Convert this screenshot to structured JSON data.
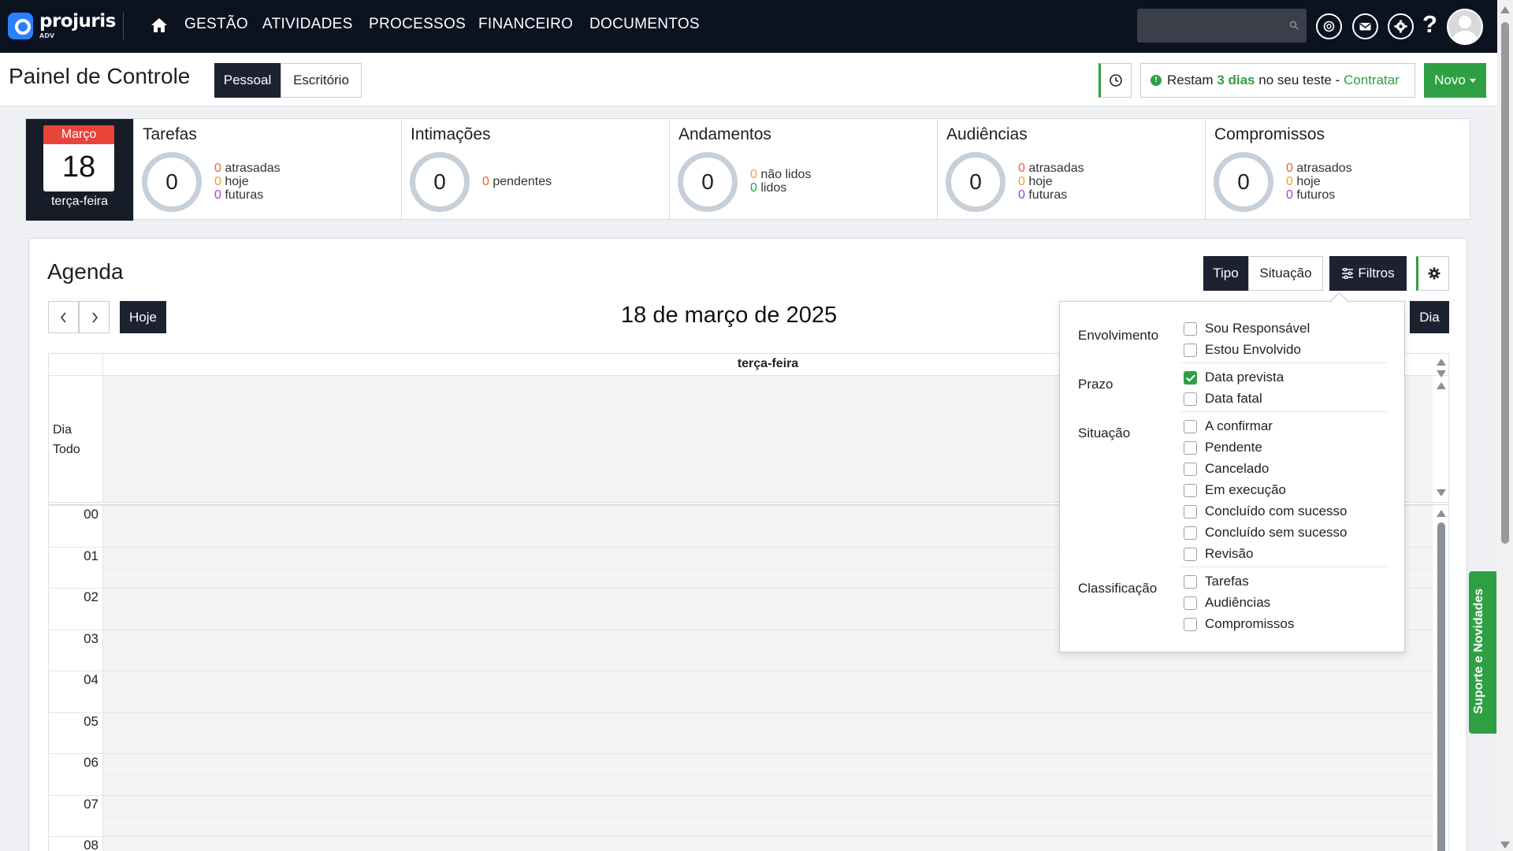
{
  "topbar": {
    "brand": "projuris",
    "brand_sub": "ADV",
    "nav": [
      "GESTÃO",
      "ATIVIDADES",
      "PROCESSOS",
      "FINANCEIRO",
      "DOCUMENTOS"
    ],
    "icons": [
      "home-icon",
      "search-icon",
      "ai-icon",
      "mail-icon",
      "settings-icon",
      "help-icon",
      "avatar"
    ],
    "help": "?"
  },
  "header": {
    "title": "Painel de Controle",
    "tabs": [
      "Pessoal",
      "Escritório"
    ],
    "trial": {
      "prefix": "Restam",
      "highlight": "3 dias",
      "middle": "no seu teste",
      "dash": "-",
      "link": "Contratar"
    },
    "new_button": "Novo"
  },
  "date_card": {
    "month": "Março",
    "day": "18",
    "weekday": "terça-feira"
  },
  "stats": [
    {
      "title": "Tarefas",
      "total": "0",
      "items": [
        {
          "count": "0",
          "label": "atrasadas"
        },
        {
          "count": "0",
          "label": "hoje"
        },
        {
          "count": "0",
          "label": "futuras"
        }
      ]
    },
    {
      "title": "Intimações",
      "total": "0",
      "items": [
        {
          "count": "0",
          "label": "pendentes"
        }
      ]
    },
    {
      "title": "Andamentos",
      "total": "0",
      "items": [
        {
          "count": "0",
          "label": "não lidos"
        },
        {
          "count": "0",
          "label": "lidos"
        }
      ]
    },
    {
      "title": "Audiências",
      "total": "0",
      "items": [
        {
          "count": "0",
          "label": "atrasadas"
        },
        {
          "count": "0",
          "label": "hoje"
        },
        {
          "count": "0",
          "label": "futuras"
        }
      ]
    },
    {
      "title": "Compromissos",
      "total": "0",
      "items": [
        {
          "count": "0",
          "label": "atrasados"
        },
        {
          "count": "0",
          "label": "hoje"
        },
        {
          "count": "0",
          "label": "futuros"
        }
      ]
    }
  ],
  "agenda": {
    "title": "Agenda",
    "toolbar": {
      "tipo": "Tipo",
      "situacao": "Situação",
      "filtros": "Filtros"
    },
    "today_button": "Hoje",
    "date_title": "18 de março de 2025",
    "view_button": "Dia",
    "day_header": "terça-feira",
    "allday_label_1": "Dia",
    "allday_label_2": "Todo",
    "hours": [
      "00",
      "01",
      "02",
      "03",
      "04",
      "05",
      "06",
      "07",
      "08"
    ]
  },
  "filters": {
    "sections": [
      {
        "label": "Envolvimento",
        "options": [
          {
            "label": "Sou Responsável",
            "checked": false
          },
          {
            "label": "Estou Envolvido",
            "checked": false
          }
        ]
      },
      {
        "label": "Prazo",
        "options": [
          {
            "label": "Data prevista",
            "checked": true
          },
          {
            "label": "Data fatal",
            "checked": false
          }
        ]
      },
      {
        "label": "Situação",
        "options": [
          {
            "label": "A confirmar",
            "checked": false
          },
          {
            "label": "Pendente",
            "checked": false
          },
          {
            "label": "Cancelado",
            "checked": false
          },
          {
            "label": "Em execução",
            "checked": false
          },
          {
            "label": "Concluído com sucesso",
            "checked": false
          },
          {
            "label": "Concluído sem sucesso",
            "checked": false
          },
          {
            "label": "Revisão",
            "checked": false
          }
        ]
      },
      {
        "label": "Classificação",
        "options": [
          {
            "label": "Tarefas",
            "checked": false
          },
          {
            "label": "Audiências",
            "checked": false
          },
          {
            "label": "Compromissos",
            "checked": false
          }
        ]
      }
    ]
  },
  "support_tab": "Suporte e Novidades",
  "colors": {
    "accent_green": "#2ea043",
    "dark": "#1c2230",
    "nav_bg": "#0b1220",
    "red": "#e8443a"
  }
}
